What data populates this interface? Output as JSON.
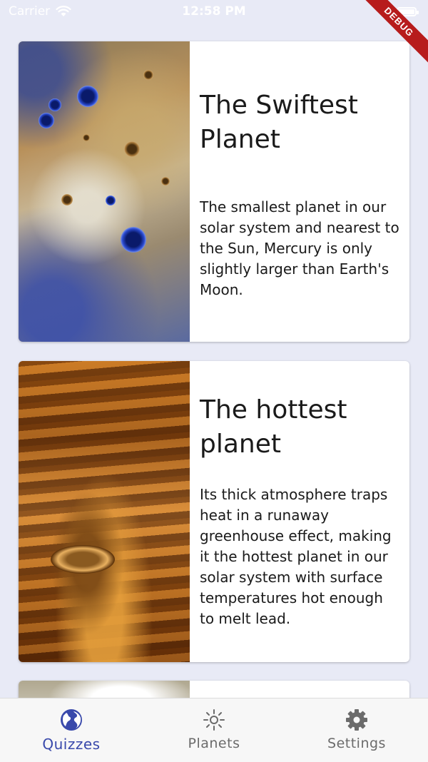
{
  "status_bar": {
    "carrier": "Carrier",
    "time": "12:58 PM",
    "debug_label": "DEBUG"
  },
  "cards": [
    {
      "title": "The Swiftest Planet",
      "body": "The smallest planet in our solar system and nearest to the Sun, Mercury is only slightly larger than Earth's Moon.",
      "image": "mercury-surface-image"
    },
    {
      "title": "The hottest planet",
      "body": "Its thick atmosphere traps heat in a runaway greenhouse effect, making it the hottest planet in our solar system with surface temperatures hot enough to melt lead.",
      "image": "venus-surface-image"
    },
    {
      "title": "",
      "body": "",
      "image": "earth-image"
    }
  ],
  "bottom_nav": {
    "items": [
      {
        "label": "Quizzes",
        "icon": "globe-icon",
        "active": true
      },
      {
        "label": "Planets",
        "icon": "sun-icon",
        "active": false
      },
      {
        "label": "Settings",
        "icon": "gear-icon",
        "active": false
      }
    ]
  },
  "colors": {
    "background": "#e8eaf6",
    "accent": "#3949ab",
    "inactive": "#6b6b6b",
    "debug_ribbon": "#b71c1c"
  }
}
